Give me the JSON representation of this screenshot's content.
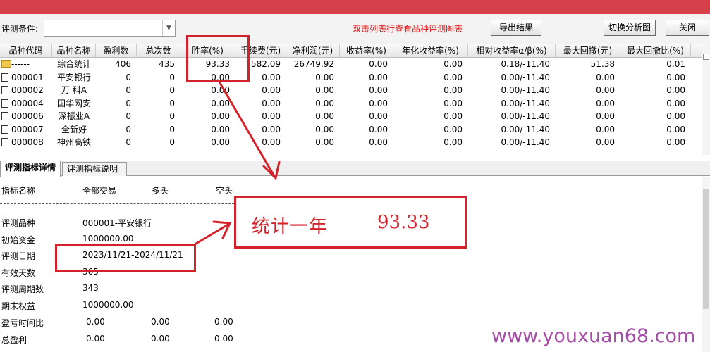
{
  "toolbar": {
    "condition_label": "评测条件:",
    "condition_value": "",
    "hint": "双击列表行查看品种评测图表",
    "export_label": "导出结果",
    "switch_label": "切换分析图",
    "close_label": "关闭"
  },
  "grid": {
    "columns": [
      "品种代码",
      "品种名称",
      "盈利数",
      "总次数",
      "胜率(%)",
      "手续费(元)",
      "净利润(元)",
      "收益率(%)",
      "年化收益率(%)",
      "相对收益率α/β(%)",
      "最大回撤(元)",
      "最大回撤比(%)"
    ],
    "rows": [
      [
        "------",
        "综合统计",
        "406",
        "435",
        "93.33",
        "1582.09",
        "26749.92",
        "0.00",
        "0.00",
        "0.18/-11.40",
        "51.38",
        "0.01"
      ],
      [
        "000001",
        "平安银行",
        "0",
        "0",
        "0.00",
        "0.00",
        "0.00",
        "0.00",
        "0.00",
        "0.00/-11.40",
        "0.00",
        "0.00"
      ],
      [
        "000002",
        "万 科A",
        "0",
        "0",
        "0.00",
        "0.00",
        "0.00",
        "0.00",
        "0.00",
        "0.00/-11.40",
        "0.00",
        "0.00"
      ],
      [
        "000004",
        "国华网安",
        "0",
        "0",
        "0.00",
        "0.00",
        "0.00",
        "0.00",
        "0.00",
        "0.00/-11.40",
        "0.00",
        "0.00"
      ],
      [
        "000006",
        "深振业A",
        "0",
        "0",
        "0.00",
        "0.00",
        "0.00",
        "0.00",
        "0.00",
        "0.00/-11.40",
        "0.00",
        "0.00"
      ],
      [
        "000007",
        "全新好",
        "0",
        "0",
        "0.00",
        "0.00",
        "0.00",
        "0.00",
        "0.00",
        "0.00/-11.40",
        "0.00",
        "0.00"
      ],
      [
        "000008",
        "神州高铁",
        "0",
        "0",
        "0.00",
        "0.00",
        "0.00",
        "0.00",
        "0.00",
        "0.00/-11.40",
        "0.00",
        "0.00"
      ]
    ]
  },
  "tabs": [
    "评测指标详情",
    "评测指标说明"
  ],
  "detail": {
    "headers": [
      "指标名称",
      "全部交易",
      "多头",
      "空头"
    ],
    "rows": [
      {
        "label": "评测品种",
        "values": [
          "000001-平安银行"
        ]
      },
      {
        "label": "初始资金",
        "values": [
          "1000000.00"
        ]
      },
      {
        "label": "评测日期",
        "values": [
          "2023/11/21-2024/11/21"
        ]
      },
      {
        "label": "有效天数",
        "values": [
          "365"
        ]
      },
      {
        "label": "评测周期数",
        "values": [
          "343"
        ]
      },
      {
        "label": "期末权益",
        "values": [
          "1000000.00"
        ]
      },
      {
        "label": "盈亏时间比",
        "values": [
          "0.00",
          "0.00",
          "0.00"
        ]
      },
      {
        "label": "总盈利",
        "values": [
          "0.00",
          "0.00",
          "0.00"
        ]
      }
    ]
  },
  "callout": {
    "text": "统计一年",
    "value": "93.33"
  },
  "watermark": "www.youxuan68.com",
  "colors": {
    "annotation": "#d4222a",
    "hint": "#e01010",
    "watermark": "#a64ca6",
    "title_bar": "#d6404a"
  }
}
